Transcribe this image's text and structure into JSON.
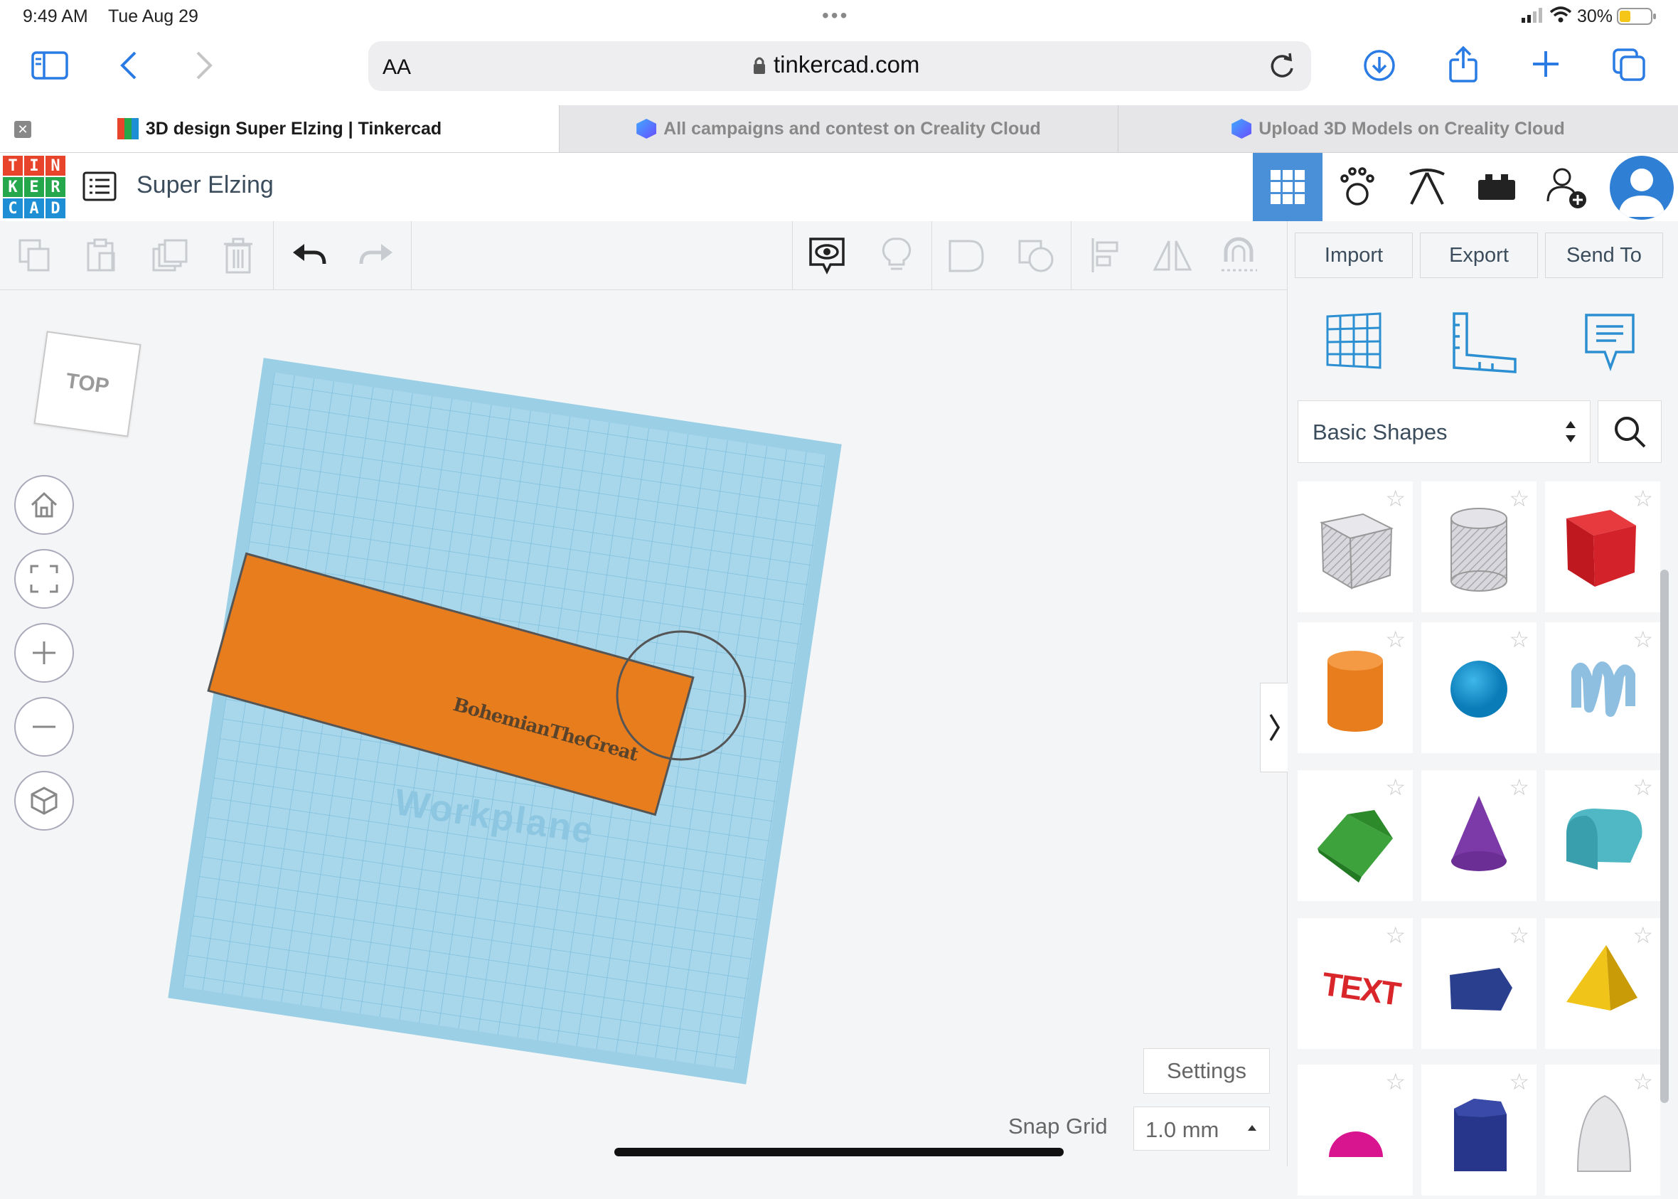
{
  "status": {
    "time": "9:49 AM",
    "date": "Tue Aug 29",
    "battery": "30%"
  },
  "browser": {
    "text_size_label": "AA",
    "url": "tinkercad.com"
  },
  "tabs": [
    {
      "label": "3D design Super Elzing | Tinkercad"
    },
    {
      "label": "All campaigns and contest on Creality Cloud"
    },
    {
      "label": "Upload 3D Models on Creality Cloud"
    }
  ],
  "logo_letters": [
    "T",
    "I",
    "N",
    "K",
    "E",
    "R",
    "C",
    "A",
    "D"
  ],
  "project": {
    "name": "Super Elzing"
  },
  "toolbar": {
    "import_label": "Import",
    "export_label": "Export",
    "send_label": "Send To"
  },
  "viewcube": {
    "label": "TOP"
  },
  "workplane": {
    "label": "Workplane",
    "engraved_text": "BohemianTheGreat"
  },
  "library": {
    "category": "Basic Shapes"
  },
  "shapes": [
    "box",
    "cylinder",
    "solid-box",
    "cylinder-solid",
    "sphere",
    "scribble",
    "roof",
    "cone",
    "round-roof",
    "text",
    "hexagonal-prism",
    "pyramid",
    "half-sphere",
    "polygon",
    "paraboloid"
  ],
  "bottom": {
    "settings_label": "Settings",
    "snap_label": "Snap Grid",
    "snap_value": "1.0 mm"
  },
  "colors": {
    "accent": "#4a90d9",
    "orange": "#e87d1e",
    "workplane": "#a8d7ec"
  }
}
